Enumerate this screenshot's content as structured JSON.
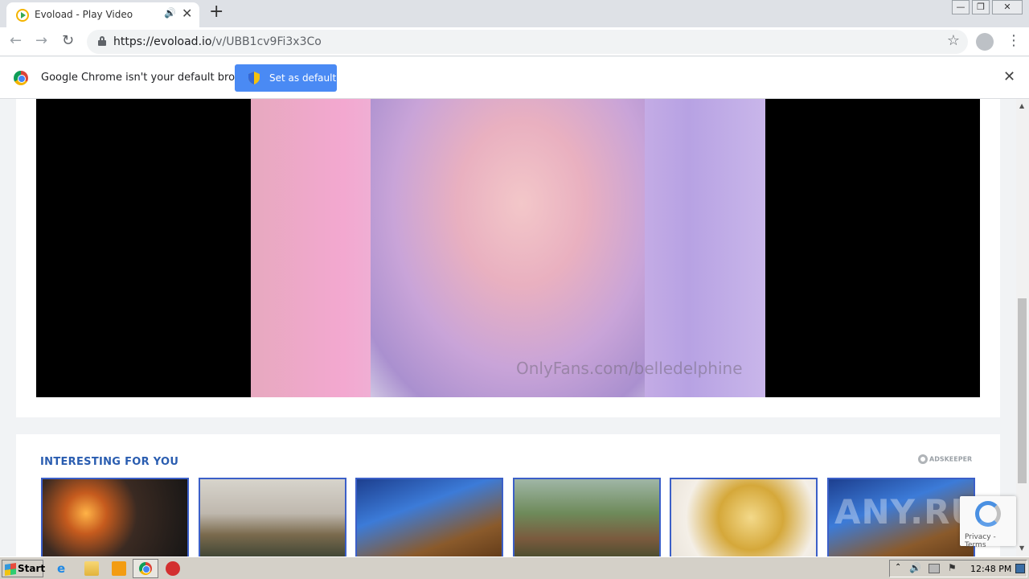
{
  "browser": {
    "tab": {
      "title": "Evoload - Play Video",
      "audio_icon": "speaker-icon",
      "close_glyph": "✕"
    },
    "new_tab_glyph": "+",
    "window_controls": {
      "minimize": "—",
      "restore": "❐",
      "close": "✕"
    },
    "nav": {
      "back_glyph": "←",
      "forward_glyph": "→",
      "reload_glyph": "↻"
    },
    "omnibox": {
      "url_host": "https://evoload.io",
      "url_path": "/v/UBB1cv9Fi3x3Co",
      "star_glyph": "☆",
      "menu_glyph": "⋮"
    },
    "infobar": {
      "message": "Google Chrome isn't your default browser",
      "button_label": "Set as default",
      "close_glyph": "✕"
    }
  },
  "page": {
    "video": {
      "watermark": "OnlyFans.com/belledelphine"
    },
    "recommendations": {
      "title": "INTERESTING FOR YOU",
      "ad_network": "ADSKEEPER",
      "thumbnails": [
        "meteor",
        "two-women-hallway",
        "fantasy-castle",
        "jungle-adventure-group",
        "bitcoin-coins",
        "fantasy-castle"
      ]
    },
    "overlay_watermark": "ANY.RUN",
    "recaptcha": {
      "links": "Privacy - Terms"
    },
    "scrollbar": {
      "up_glyph": "▲",
      "down_glyph": "▼"
    }
  },
  "taskbar": {
    "start_label": "Start",
    "ie_glyph": "e",
    "tray_arrow": "⌃",
    "speaker_glyph": "🔊",
    "flag_glyph": "⚑",
    "clock": "12:48 PM"
  },
  "colors": {
    "accent_blue": "#4a8af4",
    "title_blue": "#2a5db0",
    "thumb_border": "#3b5fc8",
    "taskbar": "#d4d0c8"
  }
}
